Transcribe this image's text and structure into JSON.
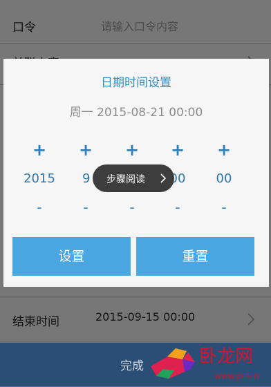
{
  "form": {
    "command": {
      "label": "口令",
      "placeholder": "请输入口令内容"
    },
    "linked_content": {
      "label": "关联内容"
    },
    "end_time": {
      "label": "结束时间",
      "value": "2015-09-15 00:00"
    }
  },
  "bottom_bar": {
    "label": "完成"
  },
  "dialog": {
    "title": "日期时间设置",
    "current": "周一 2015-08-21 00:00",
    "columns": [
      {
        "plus": "+",
        "value": "2015",
        "minus": "-"
      },
      {
        "plus": "+",
        "value": "9",
        "minus": "-"
      },
      {
        "plus": "+",
        "value": "",
        "minus": "-"
      },
      {
        "plus": "+",
        "value": "00",
        "minus": "-"
      },
      {
        "plus": "+",
        "value": "00",
        "minus": "-"
      }
    ],
    "set_button": "设置",
    "reset_button": "重置"
  },
  "toast": {
    "label": "步骤阅读"
  },
  "watermark": {
    "text": "卧龙网",
    "url": "www.pcfcn"
  },
  "colors": {
    "accent": "#4aa6e0",
    "title_blue": "#2f8fc6",
    "bar": "#2a4e76"
  },
  "icons": {
    "row_chevron": "chevron-right-icon",
    "toast_arrow": "chevron-right-icon"
  }
}
